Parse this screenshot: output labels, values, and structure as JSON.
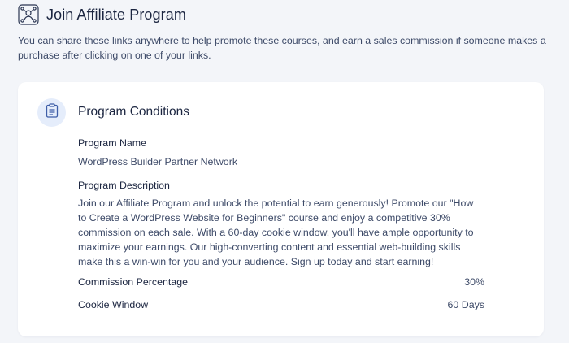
{
  "header": {
    "icon": "affiliate-network-icon",
    "title": "Join Affiliate Program"
  },
  "intro": {
    "text": "You can share these links anywhere to help promote these courses, and earn a sales commission if someone makes a purchase after clicking on one of your links."
  },
  "card": {
    "icon": "clipboard-icon",
    "title": "Program Conditions",
    "program_name_label": "Program Name",
    "program_name_value": "WordPress Builder Partner Network",
    "program_description_label": "Program Description",
    "program_description_value": "Join our Affiliate Program and unlock the potential to earn generously! Promote our \"How to Create a WordPress Website for Beginners\" course and enjoy a competitive 30% commission on each sale. With a 60-day cookie window, you'll have ample opportunity to maximize your earnings. Our high-converting content and essential web-building skills make this a win-win for you and your audience. Sign up today and start earning!",
    "commission_label": "Commission Percentage",
    "commission_value": "30%",
    "cookie_label": "Cookie Window",
    "cookie_value": "60 Days"
  },
  "colors": {
    "background": "#f3f5f9",
    "card": "#ffffff",
    "heading": "#1b2540",
    "body_text": "#3d4a68",
    "icon_circle": "#e5edfb",
    "icon_stroke": "#3e5ea8"
  }
}
